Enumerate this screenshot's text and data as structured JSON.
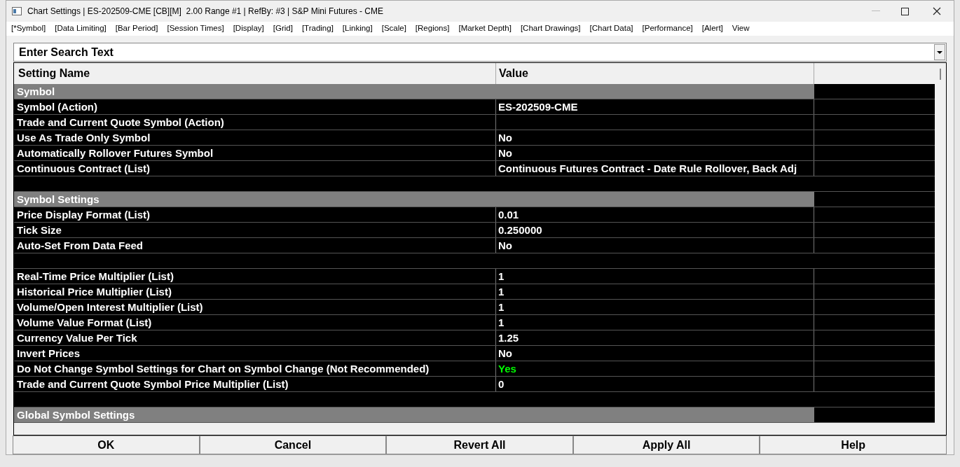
{
  "window": {
    "title": "Chart Settings | ES-202509-CME [CB][M]  2.00 Range #1 | RefBy: #3 | S&P Mini Futures - CME"
  },
  "tabs": [
    "[*Symbol]",
    "[Data Limiting]",
    "[Bar Period]",
    "[Session Times]",
    "[Display]",
    "[Grid]",
    "[Trading]",
    "[Linking]",
    "[Scale]",
    "[Regions]",
    "[Market Depth]",
    "[Chart Drawings]",
    "[Chart Data]",
    "[Performance]",
    "[Alert]",
    "View"
  ],
  "search": {
    "placeholder": "Enter Search Text"
  },
  "table": {
    "columns": [
      "Setting Name",
      "Value"
    ],
    "rows": [
      {
        "kind": "section",
        "name": "Symbol"
      },
      {
        "kind": "setting",
        "name": "Symbol (Action)",
        "value": "ES-202509-CME",
        "color": "#ffffff"
      },
      {
        "kind": "setting",
        "name": "Trade and Current Quote Symbol (Action)",
        "value": ""
      },
      {
        "kind": "setting",
        "name": "Use As Trade Only Symbol",
        "value": "No",
        "color": "#ffffff"
      },
      {
        "kind": "setting",
        "name": "Automatically Rollover Futures Symbol",
        "value": "No",
        "color": "#ffffff"
      },
      {
        "kind": "setting",
        "name": "Continuous Contract (List)",
        "value": "Continuous Futures Contract - Date Rule Rollover, Back Adj",
        "color": "#ffffff"
      },
      {
        "kind": "blank"
      },
      {
        "kind": "section",
        "name": "Symbol Settings"
      },
      {
        "kind": "setting",
        "name": "Price Display Format (List)",
        "value": "0.01",
        "color": "#ffffff"
      },
      {
        "kind": "setting",
        "name": "Tick Size",
        "value": "0.250000",
        "color": "#ffffff"
      },
      {
        "kind": "setting",
        "name": "Auto-Set From Data Feed",
        "value": "No",
        "color": "#ffffff"
      },
      {
        "kind": "blank"
      },
      {
        "kind": "setting",
        "name": "Real-Time Price Multiplier (List)",
        "value": "1",
        "color": "#ffffff"
      },
      {
        "kind": "setting",
        "name": "Historical Price Multiplier (List)",
        "value": "1",
        "color": "#ffffff"
      },
      {
        "kind": "setting",
        "name": "Volume/Open Interest Multiplier (List)",
        "value": "1",
        "color": "#ffffff"
      },
      {
        "kind": "setting",
        "name": "Volume Value Format (List)",
        "value": "1",
        "color": "#ffffff"
      },
      {
        "kind": "setting",
        "name": "Currency Value Per Tick",
        "value": "1.25",
        "color": "#ffffff"
      },
      {
        "kind": "setting",
        "name": "Invert Prices",
        "value": "No",
        "color": "#ffffff"
      },
      {
        "kind": "setting",
        "name": "Do Not Change Symbol Settings for Chart on Symbol Change (Not Recommended)",
        "value": "Yes",
        "color": "#00ff00"
      },
      {
        "kind": "setting",
        "name": "Trade and Current Quote Symbol Price Multiplier (List)",
        "value": "0",
        "color": "#ffffff"
      },
      {
        "kind": "blank"
      },
      {
        "kind": "section",
        "name": "Global Symbol Settings"
      }
    ]
  },
  "buttons": [
    "OK",
    "Cancel",
    "Revert All",
    "Apply All",
    "Help"
  ]
}
